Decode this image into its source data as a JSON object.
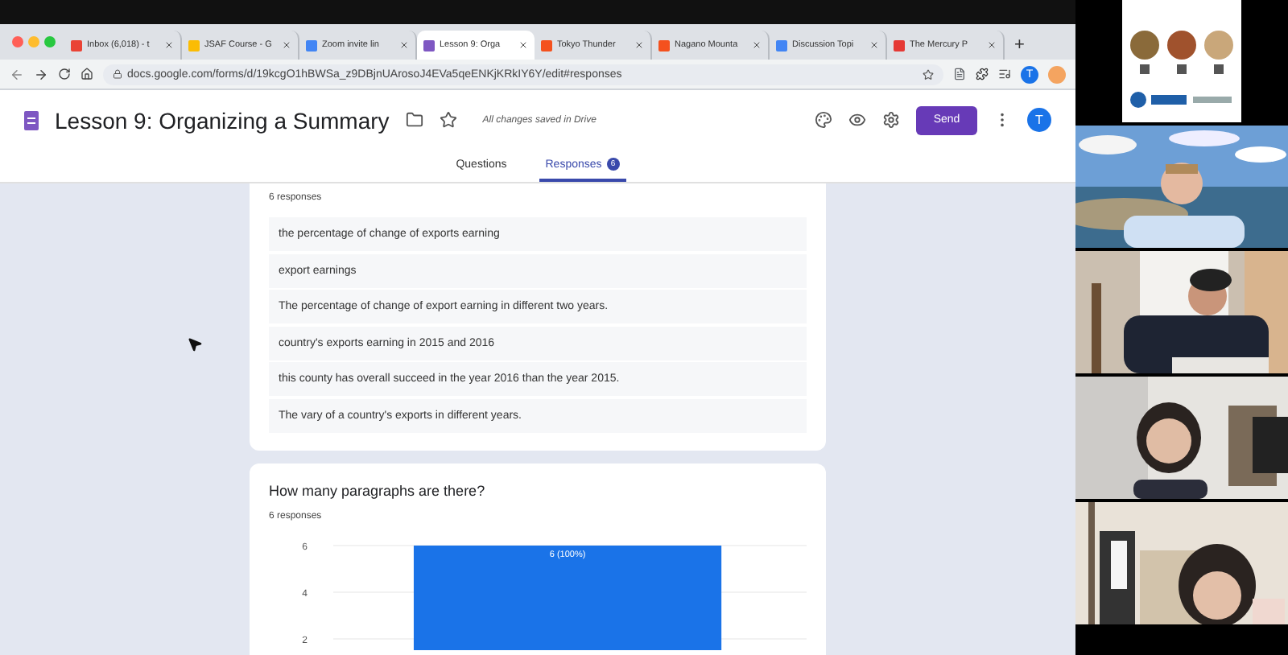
{
  "browser": {
    "tabs": [
      {
        "title": "Inbox (6,018) - t",
        "color": "#ea4335",
        "selected": false
      },
      {
        "title": "JSAF Course - G",
        "color": "#fbbc04",
        "selected": false
      },
      {
        "title": "Zoom invite lin",
        "color": "#4285f4",
        "selected": false
      },
      {
        "title": "Lesson 9: Orga",
        "color": "#7e57c2",
        "selected": true
      },
      {
        "title": "Tokyo Thunder",
        "color": "#f4511e",
        "selected": false
      },
      {
        "title": "Nagano Mounta",
        "color": "#f4511e",
        "selected": false
      },
      {
        "title": "Discussion Topi",
        "color": "#4285f4",
        "selected": false
      },
      {
        "title": "The Mercury P",
        "color": "#e53935",
        "selected": false
      }
    ],
    "new_tab": "+",
    "address": "docs.google.com/forms/d/19kcgO1hBWSa_z9DBjnUArosoJ4EVa5qeENKjKRkIY6Y/edit#responses",
    "profile": "T"
  },
  "form": {
    "title": "Lesson 9: Organizing a Summary",
    "save_status": "All changes saved in Drive",
    "send": "Send",
    "account": "T",
    "tabs": [
      {
        "label": "Questions",
        "selected": false
      },
      {
        "label": "Responses",
        "badge": "6",
        "selected": true
      }
    ]
  },
  "questions": [
    {
      "kind": "text",
      "count": "6 responses",
      "answers": [
        "the percentage of change of exports earning",
        "export earnings",
        "The percentage of change of export earning in different two years.",
        "country's exports earning in 2015 and 2016",
        "this county has overall succeed in the year 2016 than the year 2015.",
        "The vary of a country's exports in different years."
      ]
    },
    {
      "kind": "chart",
      "title": "How many paragraphs are there?",
      "count": "6 responses",
      "chart_data": {
        "type": "bar",
        "values": [
          6
        ],
        "ylim": [
          1.5,
          6
        ],
        "yticks": [
          2,
          4,
          6
        ],
        "value_labels": [
          "6 (100%)"
        ]
      }
    }
  ]
}
